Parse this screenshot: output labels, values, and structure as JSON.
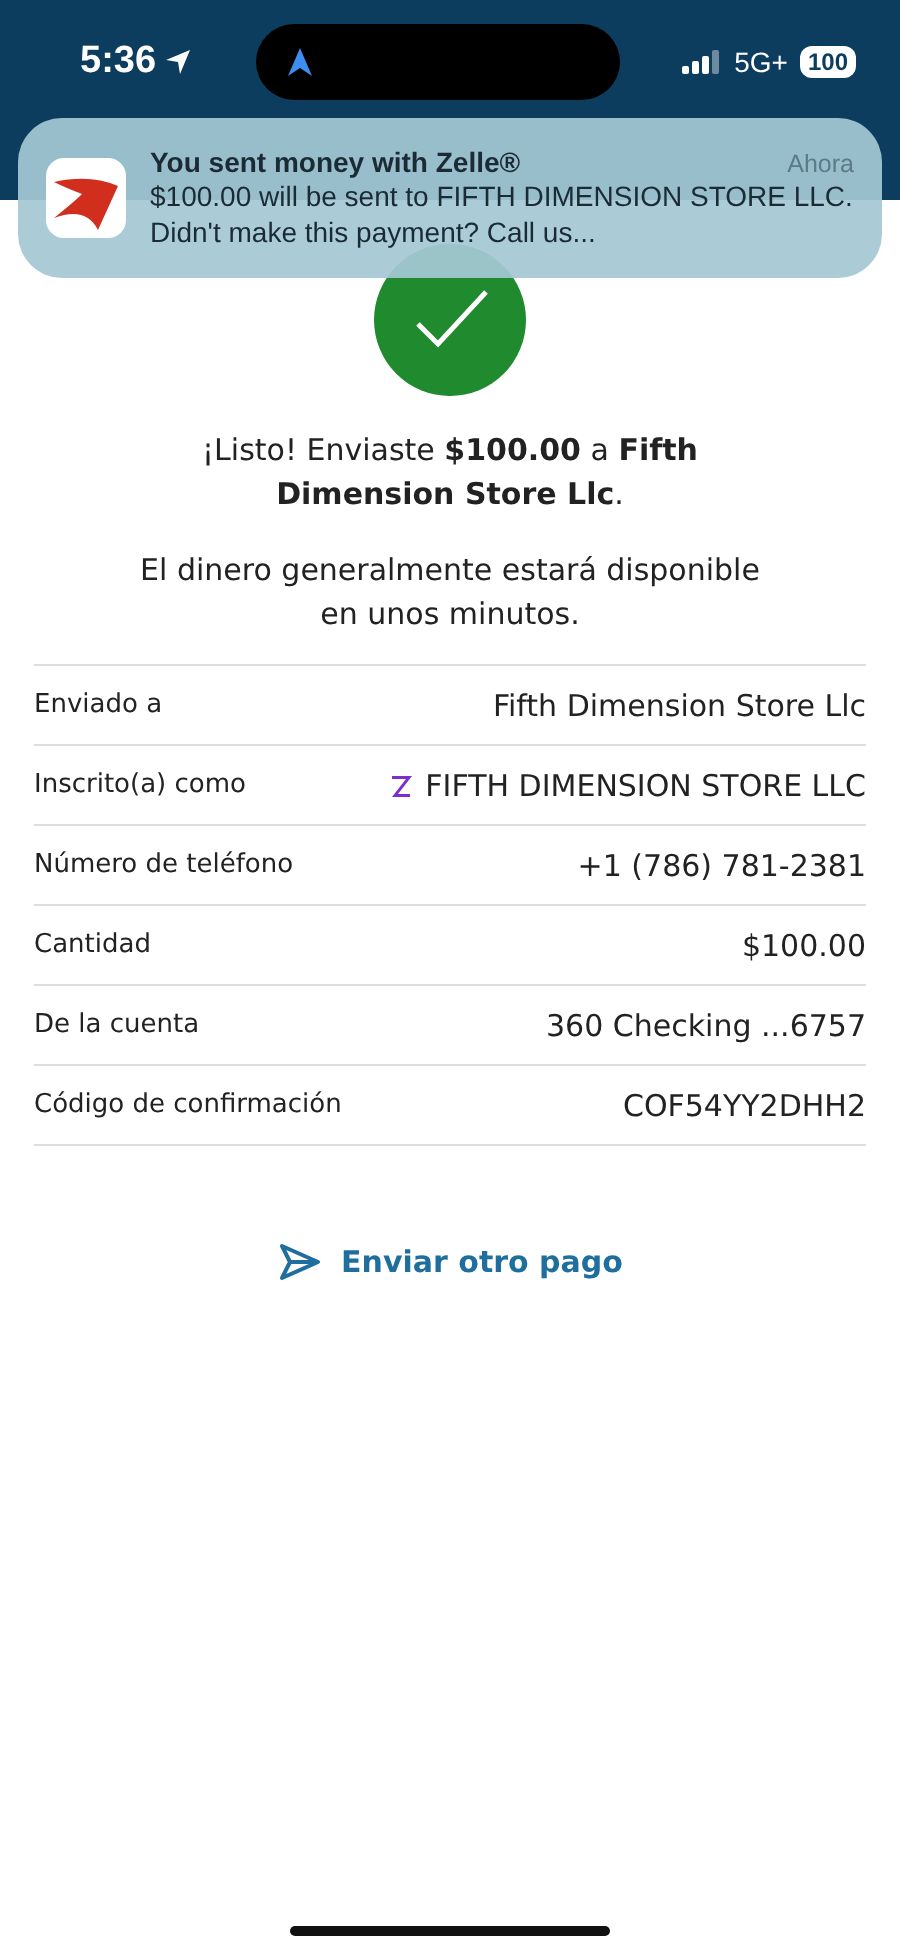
{
  "status_bar": {
    "time": "5:36",
    "network": "5G+",
    "battery": "100"
  },
  "notification": {
    "title": "You sent money with Zelle®",
    "time": "Ahora",
    "body": "$100.00 will be sent to FIFTH DIMENSION STORE LLC. Didn't make this payment? Call us..."
  },
  "confirmation": {
    "message": "¡Listo! Enviaste **$100.00** a **Fifth Dimension Store Llc**.",
    "note": "El dinero generalmente estará disponible en unos minutos."
  },
  "details": [
    {
      "label": "Enviado a",
      "value": "Fifth Dimension Store Llc",
      "kind": "plain"
    },
    {
      "label": "Inscrito(a) como",
      "value": "FIFTH DIMENSION STORE LLC",
      "kind": "zelle"
    },
    {
      "label": "Número de teléfono",
      "value": "+1 (786) 781-2381",
      "kind": "plain"
    },
    {
      "label": "Cantidad",
      "value": "$100.00",
      "kind": "plain"
    },
    {
      "label": "De la cuenta",
      "value": "360 Checking ...6757",
      "kind": "plain"
    },
    {
      "label": "Código de confirmación",
      "value": "COF54YY2DHH2",
      "kind": "plain"
    }
  ],
  "action": {
    "label": "Enviar otro pago"
  }
}
